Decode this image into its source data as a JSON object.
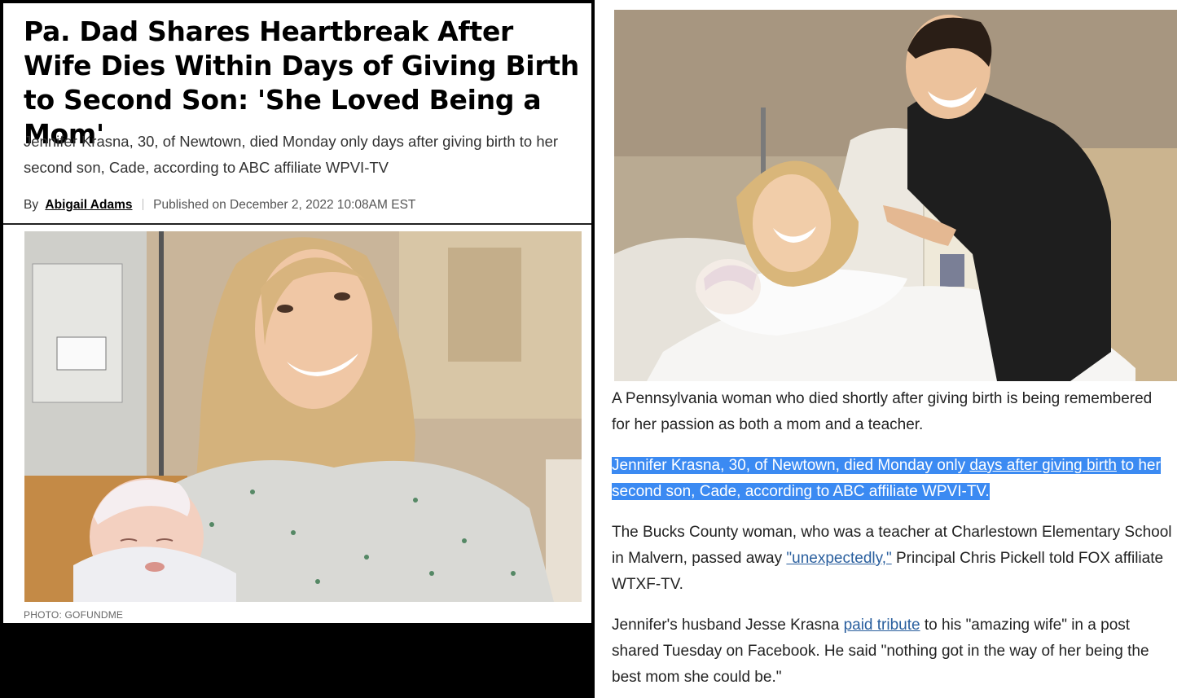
{
  "left_article": {
    "headline": "Pa. Dad Shares Heartbreak After Wife Dies Within Days of Giving Birth to Second Son: 'She Loved Being a Mom'",
    "dek": "Jennifer Krasna, 30, of Newtown, died Monday only days after giving birth to her second son, Cade, according to ABC affiliate WPVI-TV",
    "by_label": "By",
    "author": "Abigail Adams",
    "published": "Published on December 2, 2022 10:08AM EST",
    "photo_credit": "PHOTO: GOFUNDME"
  },
  "right_article": {
    "p1": "A Pennsylvania woman who died shortly after giving birth is being remembered for her passion as both a mom and a teacher.",
    "p2_a": "Jennifer Krasna, 30, of Newtown, died Monday only ",
    "p2_link": "days after giving birth",
    "p2_b": " to her second son, Cade, according to ABC affiliate WPVI-TV.",
    "p3_a": "The Bucks County woman, who was a teacher at Charlestown Elementary School in Malvern, passed away ",
    "p3_link": "\"unexpectedly,\"",
    "p3_b": " Principal Chris Pickell told FOX affiliate WTXF-TV.",
    "p4_a": "Jennifer's husband Jesse Krasna ",
    "p4_link": "paid tribute",
    "p4_b": " to his \"amazing wife\" in a post shared Tuesday on Facebook. He said \"nothing got in the way of her being the best mom she could be.\""
  },
  "colors": {
    "highlight": "#3b8af2",
    "link": "#2a5f9e"
  }
}
